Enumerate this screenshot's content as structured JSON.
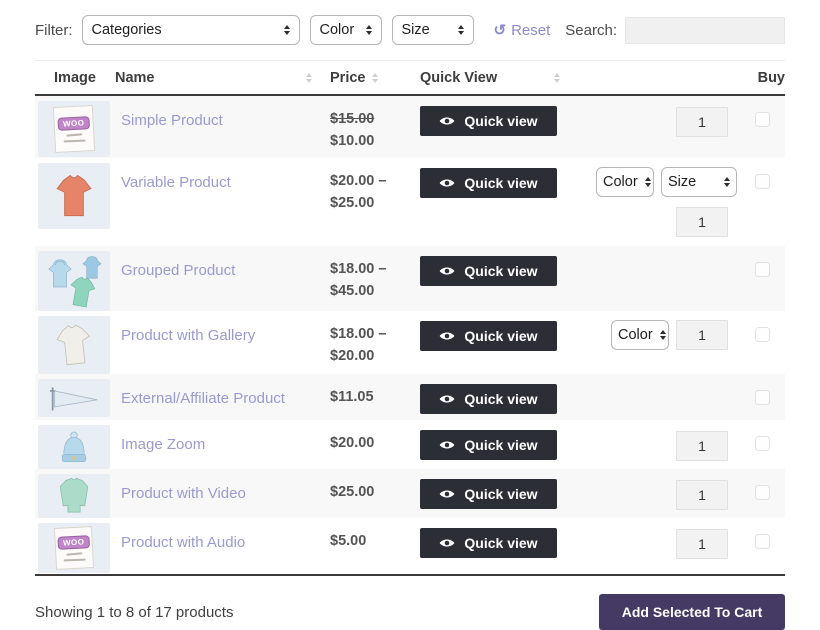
{
  "filter_bar": {
    "filter_label": "Filter:",
    "categories_label": "Categories",
    "color_label": "Color",
    "size_label": "Size",
    "reset_label": "Reset",
    "reset_icon": "↺",
    "search_label": "Search:",
    "search_value": ""
  },
  "table": {
    "headers": {
      "image": "Image",
      "name": "Name",
      "price": "Price",
      "quick_view": "Quick View",
      "variations": "",
      "buy": "Buy"
    },
    "quick_view_label": "Quick view",
    "woo_badge_text": "WOO",
    "rows": [
      {
        "name": "Simple Product",
        "price_line1": "$15.00",
        "price_line2": "$10.00",
        "qty": "1",
        "thumb": "woo-poster"
      },
      {
        "name": "Variable Product",
        "price_line1": "$20.00 –",
        "price_line2": "$25.00",
        "selects": [
          "Color",
          "Size"
        ],
        "qty": "1",
        "thumb": "coral-tshirt"
      },
      {
        "name": "Grouped Product",
        "price_line1": "$18.00 –",
        "price_line2": "$45.00",
        "thumb": "hoodie-and-tshirt"
      },
      {
        "name": "Product with Gallery",
        "price_line1": "$18.00 –",
        "price_line2": "$20.00",
        "selects": [
          "Color"
        ],
        "qty": "1",
        "thumb": "white-tshirt"
      },
      {
        "name": "External/Affiliate Product",
        "price_line1": "$11.05",
        "thumb": "pennant-flag"
      },
      {
        "name": "Image Zoom",
        "price_line1": "$20.00",
        "qty": "1",
        "thumb": "blue-beanie"
      },
      {
        "name": "Product with Video",
        "price_line1": "$25.00",
        "qty": "1",
        "thumb": "teal-longsleeve"
      },
      {
        "name": "Product with Audio",
        "price_line1": "$5.00",
        "qty": "1",
        "thumb": "woo-poster"
      }
    ]
  },
  "footer": {
    "showing_text": "Showing 1 to 8 of 17 products",
    "add_to_cart_label": "Add Selected To Cart"
  },
  "colors": {
    "link": "#9a9ad0",
    "reset_link": "#8b8bcb",
    "quick_view_bg": "#2c2e35",
    "add_to_cart_bg": "#453a63",
    "row_stripe": "#f8f8f8",
    "qty_bg": "#f2f2f2",
    "search_bg": "#f0f0f0",
    "header_text": "#3d3d3d",
    "price_text": "#545454"
  }
}
